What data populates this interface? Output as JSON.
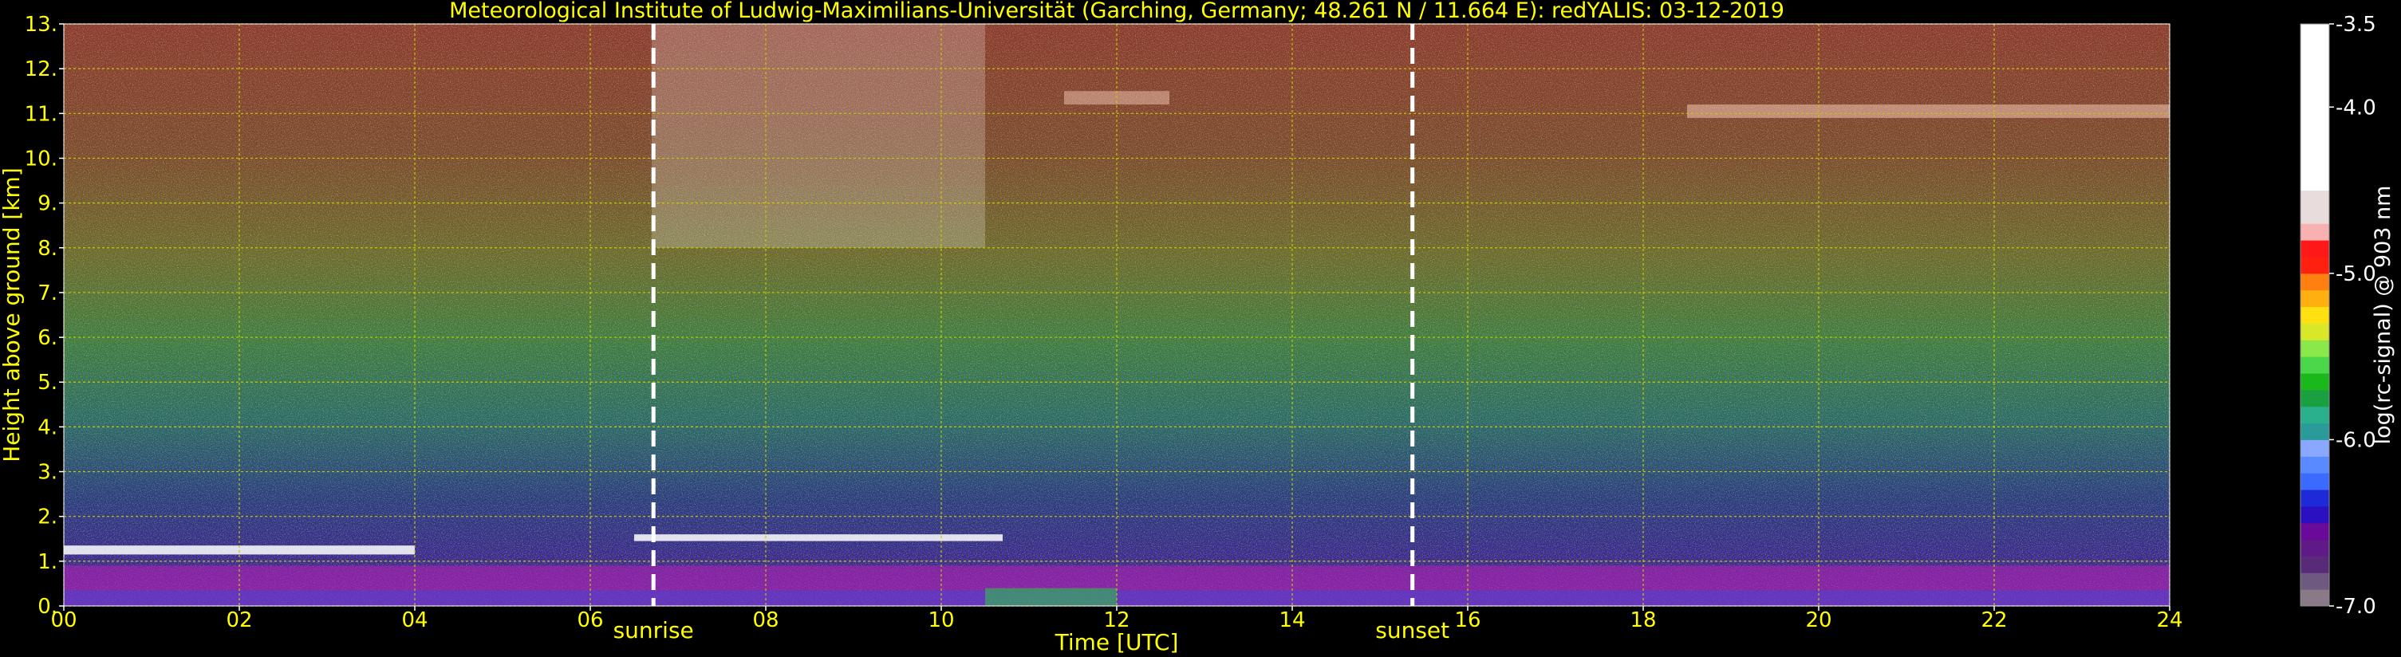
{
  "chart_data": {
    "type": "heatmap",
    "title": "Meteorological Institute of Ludwig-Maximilians-Universität (Garching, Germany; 48.261 N / 11.664 E):    redYALIS: 03-12-2019",
    "xlabel": "Time [UTC]",
    "ylabel": "Height above ground [km]",
    "colorbar_label": "log(rc-signal) @ 903 nm",
    "xlim": [
      0,
      24
    ],
    "ylim": [
      0,
      13
    ],
    "x_ticks": [
      0,
      2,
      4,
      6,
      8,
      10,
      12,
      14,
      16,
      18,
      20,
      22,
      24
    ],
    "x_tick_labels": [
      "00",
      "02",
      "04",
      "06",
      "08",
      "10",
      "12",
      "14",
      "16",
      "18",
      "20",
      "22",
      "24"
    ],
    "y_ticks": [
      0,
      1,
      2,
      3,
      4,
      5,
      6,
      7,
      8,
      9,
      10,
      11,
      12,
      13
    ],
    "y_tick_labels": [
      "0.",
      "1.",
      "2.",
      "3.",
      "4.",
      "5.",
      "6.",
      "7.",
      "8.",
      "9.",
      "10.",
      "11.",
      "12.",
      "13."
    ],
    "colorbar_range": [
      -7.0,
      -3.5
    ],
    "colorbar_ticks": [
      -7.0,
      -6.0,
      -5.0,
      -4.0,
      -3.5
    ],
    "colorbar_tick_labels": [
      "-7.0",
      "-6.0",
      "-5.0",
      "-4.0",
      "-3.5"
    ],
    "grid": true,
    "markers": [
      {
        "label": "sunrise",
        "x": 6.72
      },
      {
        "label": "sunset",
        "x": 15.37
      }
    ],
    "colors": {
      "text": "#ffff00",
      "grid": "#c8c800",
      "marker_line": "#ffffff",
      "colorbar_text": "#ffffff"
    }
  }
}
